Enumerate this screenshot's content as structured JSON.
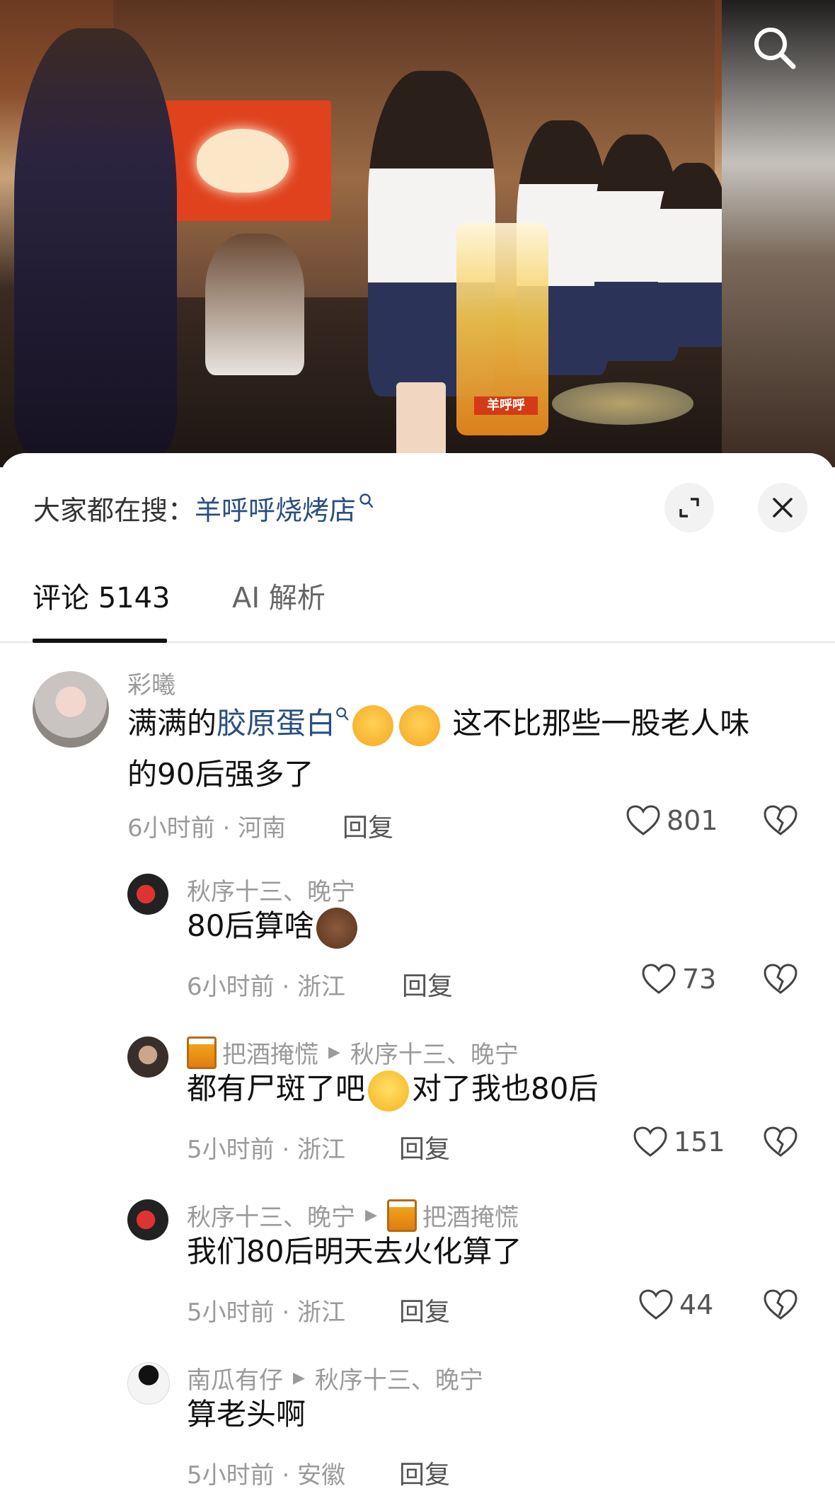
{
  "video": {
    "jar_label": "羊呼呼"
  },
  "search_bar": {
    "prefix": "大家都在搜：",
    "keyword": "羊呼呼烧烤店"
  },
  "tabs": [
    {
      "label": "评论 5143",
      "active": true
    },
    {
      "label": "AI 解析",
      "active": false
    }
  ],
  "comments": [
    {
      "user": "彩曦",
      "text_before": "满满的",
      "text_highlight": "胶原蛋白",
      "text_after_line1": "这不比那些一股老人味",
      "text_line2": "的90后强多了",
      "time_location": "6小时前 · 河南",
      "reply_label": "回复",
      "likes": "801"
    },
    {
      "user": "秋序十三、晚宁",
      "text": "80后算啥",
      "time_location": "6小时前 · 浙江",
      "reply_label": "回复",
      "likes": "73"
    },
    {
      "user": "把酒掩慌",
      "reply_to": "秋序十三、晚宁",
      "text_before": "都有尸斑了吧",
      "text_after": "对了我也80后",
      "time_location": "5小时前 · 浙江",
      "reply_label": "回复",
      "likes": "151"
    },
    {
      "user": "秋序十三、晚宁",
      "reply_to": "把酒掩慌",
      "text": "我们80后明天去火化算了",
      "time_location": "5小时前 · 浙江",
      "reply_label": "回复",
      "likes": "44"
    },
    {
      "user": "南瓜有仔",
      "reply_to": "秋序十三、晚宁",
      "text": "算老头啊",
      "time_location": "5小时前 · 安徽",
      "reply_label": "回复"
    }
  ],
  "colors": {
    "keyword": "#2a4f80",
    "meta": "#9a9a9a"
  }
}
